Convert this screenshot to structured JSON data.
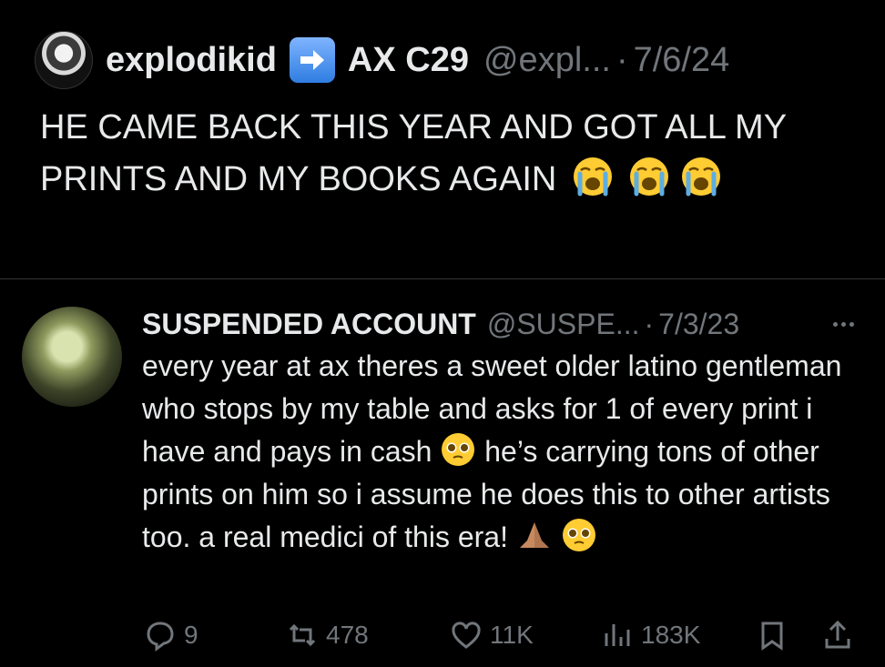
{
  "quoting_tweet": {
    "display_name": "explodikid",
    "display_name_suffix": "AX C29",
    "handle": "@expl...",
    "separator": "·",
    "date": "7/6/24",
    "text": "HE CAME BACK THIS YEAR AND GOT ALL MY PRINTS AND MY BOOKS AGAIN",
    "trailing_emojis": [
      "loudly-crying-face",
      "loudly-crying-face",
      "loudly-crying-face"
    ]
  },
  "quoted_tweet": {
    "display_name": "SUSPENDED ACCOUNT",
    "handle": "@SUSPE...",
    "separator": "·",
    "date": "7/3/23",
    "text_part1": "every year at ax theres a sweet older latino gentleman who stops by my table and asks for 1 of every print i have and pays in cash",
    "text_part2": "he’s carrying tons of other prints on him so i assume he does this to other artists too. a real medici of this era!",
    "emojis": [
      "pleading-face",
      "folded-hands",
      "pleading-face"
    ]
  },
  "actions": {
    "replies": "9",
    "retweets": "478",
    "likes": "11K",
    "views": "183K"
  },
  "colors": {
    "background": "#000000",
    "text": "#e7e9ea",
    "muted": "#71767b",
    "divider": "#2f3336",
    "arrow_badge": "#2f7de1"
  }
}
